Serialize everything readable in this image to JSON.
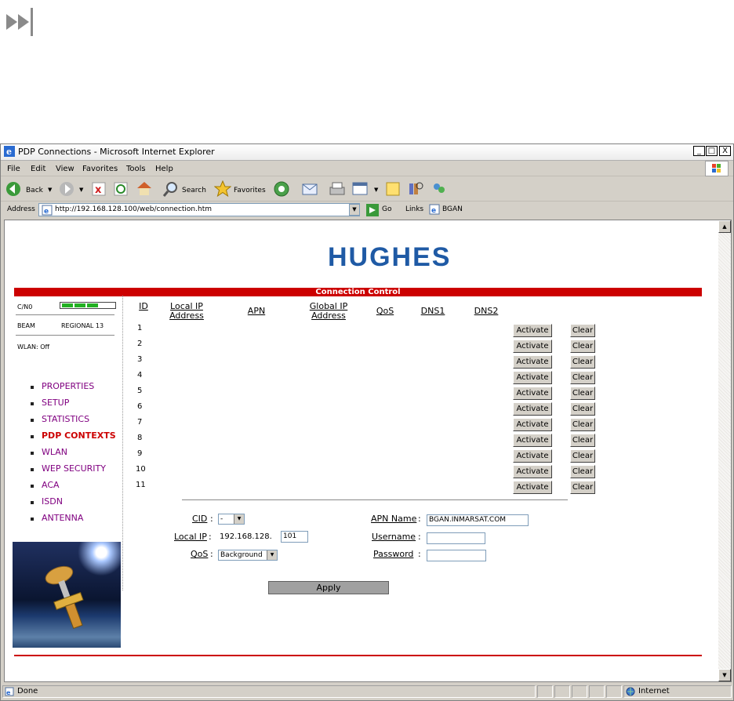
{
  "window": {
    "title": "PDP Connections - Microsoft Internet Explorer",
    "controls": [
      "_",
      "□",
      "X"
    ]
  },
  "menu": [
    "File",
    "Edit",
    "View",
    "Favorites",
    "Tools",
    "Help"
  ],
  "toolbar": {
    "back": "Back",
    "search": "Search",
    "favorites": "Favorites"
  },
  "address": {
    "label": "Address",
    "url": "http://192.168.128.100/web/connection.htm",
    "go": "Go",
    "links": "Links",
    "bookmark": "BGAN"
  },
  "page": {
    "logo": "HUGHES",
    "section_title": "Connection Control",
    "signal_label": "C/N0",
    "beam_label": "BEAM",
    "beam_value": "REGIONAL 13",
    "wlan_status": "WLAN: Off",
    "nav": [
      {
        "label": "PROPERTIES",
        "current": false
      },
      {
        "label": "SETUP",
        "current": false
      },
      {
        "label": "STATISTICS",
        "current": false
      },
      {
        "label": "PDP CONTEXTS",
        "current": true
      },
      {
        "label": "WLAN",
        "current": false
      },
      {
        "label": "WEP SECURITY",
        "current": false
      },
      {
        "label": "ACA",
        "current": false
      },
      {
        "label": "ISDN",
        "current": false
      },
      {
        "label": "ANTENNA",
        "current": false
      }
    ],
    "table": {
      "headers": [
        "ID",
        "Local IP Address",
        "APN",
        "Global IP Address",
        "QoS",
        "DNS1",
        "DNS2"
      ],
      "rows": [
        "1",
        "2",
        "3",
        "4",
        "5",
        "6",
        "7",
        "8",
        "9",
        "10",
        "11"
      ],
      "activate_label": "Activate",
      "clear_label": "Clear"
    },
    "form": {
      "cid_label": "CID",
      "cid_value": "-",
      "local_ip_label": "Local IP",
      "local_ip_prefix": "192.168.128.",
      "local_ip_value": "101",
      "qos_label": "QoS",
      "qos_value": "Background",
      "apn_label": "APN Name",
      "apn_value": "BGAN.INMARSAT.COM",
      "username_label": "Username",
      "username_value": "",
      "password_label": "Password",
      "password_value": "",
      "apply_label": "Apply"
    }
  },
  "status": {
    "text": "Done",
    "zone": "Internet"
  }
}
